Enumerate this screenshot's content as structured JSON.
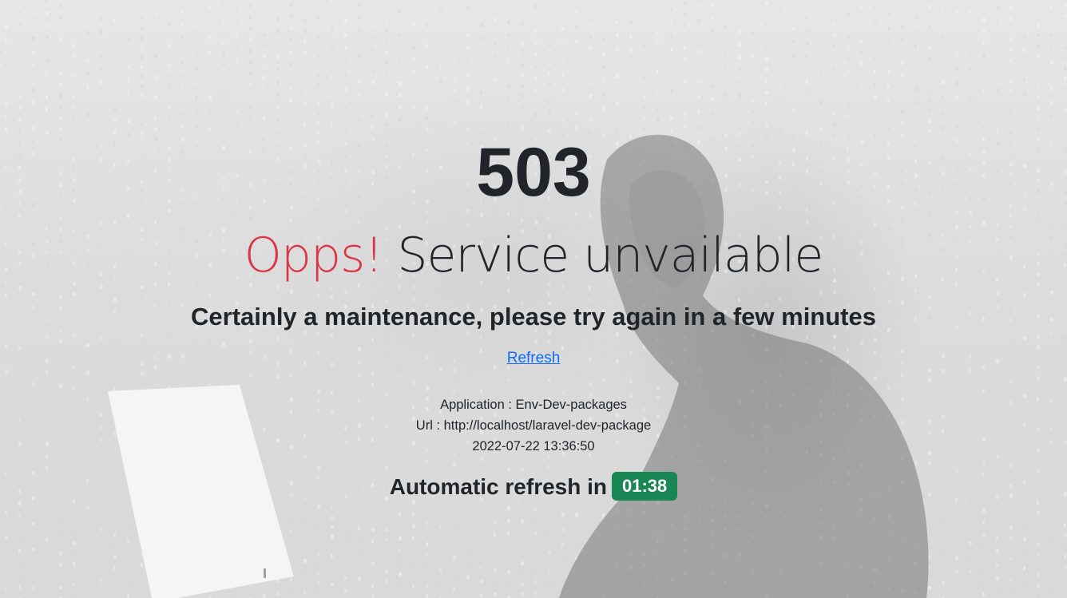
{
  "error": {
    "code": "503",
    "headline_accent": "Opps!",
    "headline_text": "Service unvailable",
    "message": "Certainly a maintenance, please try again in a few minutes"
  },
  "refresh_link": {
    "label": "Refresh"
  },
  "meta": {
    "application": "Application : Env-Dev-packages",
    "url": "Url : http://localhost/laravel-dev-package",
    "datetime": "2022-07-22 13:36:50"
  },
  "auto_refresh": {
    "label": "Automatic refresh in",
    "countdown": "01:38"
  },
  "colors": {
    "accent_red": "#dc3545",
    "link_blue": "#0d6efd",
    "badge_green": "#198754",
    "text_dark": "#212529"
  }
}
